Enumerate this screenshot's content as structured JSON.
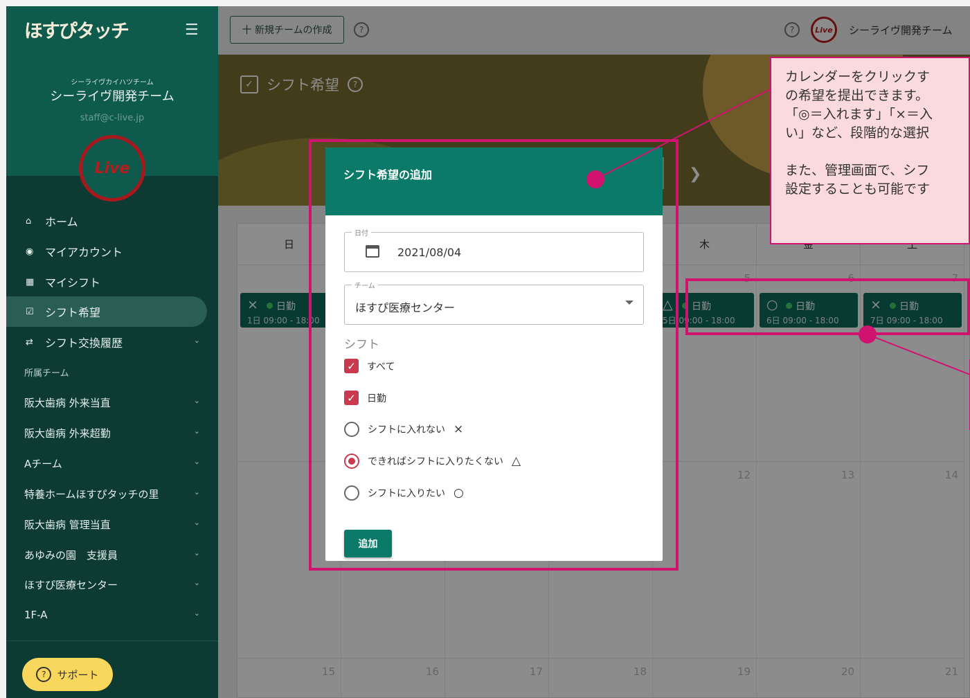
{
  "sidebar": {
    "logo": "ほすぴタッチ",
    "org_kana": "シーライヴカイハツチーム",
    "org_name": "シーライヴ開発チーム",
    "org_email": "staff@c-live.jp",
    "avatar_text": "Live",
    "nav": [
      {
        "label": "ホーム"
      },
      {
        "label": "マイアカウント"
      },
      {
        "label": "マイシフト"
      },
      {
        "label": "シフト希望"
      },
      {
        "label": "シフト交換履歴"
      }
    ],
    "teams_heading": "所属チーム",
    "teams": [
      "阪大歯病 外来当直",
      "阪大歯病 外来超勤",
      "Aチーム",
      "特養ホームほすぴタッチの里",
      "阪大歯病 管理当直",
      "あゆみの園　支援員",
      "ほすぴ医療センター",
      "1F-A"
    ],
    "support_label": "サポート"
  },
  "topbar": {
    "new_team_label": "十 新規チームの作成",
    "brand_mini": "Live",
    "team_selector": "シーライヴ開発チーム"
  },
  "page": {
    "title": "シフト希望"
  },
  "calendar": {
    "weekdays": [
      "日",
      "",
      "",
      "",
      "木",
      "金",
      "土"
    ],
    "week1_dates": [
      "",
      "",
      "",
      "",
      "5",
      "6",
      "7"
    ],
    "week2_dates": [
      "",
      "",
      "",
      "",
      "12",
      "13",
      "14"
    ],
    "week3_dates": [
      "15",
      "16",
      "17",
      "18",
      "19",
      "20",
      "21"
    ],
    "chips": [
      {
        "mark": "×",
        "label": "日勤",
        "time": "1日 09:00 - 18:00"
      },
      {
        "mark": "△",
        "label": "日勤",
        "time": "5日 09:00 - 18:00"
      },
      {
        "mark": "○",
        "label": "日勤",
        "time": "6日 09:00 - 18:00"
      },
      {
        "mark": "×",
        "label": "日勤",
        "time": "7日 09:00 - 18:00"
      }
    ]
  },
  "dialog": {
    "title": "シフト希望の追加",
    "date_label": "日付",
    "date_value": "2021/08/04",
    "team_label": "チーム",
    "team_value": "ほすぴ医療センター",
    "shift_label": "シフト",
    "checkboxes": [
      "すべて",
      "日勤"
    ],
    "radios": [
      {
        "label": "シフトに入れない",
        "symbol": "×"
      },
      {
        "label": "できればシフトに入りたくない",
        "symbol": "△"
      },
      {
        "label": "シフトに入りたい",
        "symbol": "○"
      }
    ],
    "selected_radio": "できればシフトに入りたくない",
    "add_label": "追加"
  },
  "callout": {
    "text": "カレンダーをクリックす\nの希望を提出できます。\n「◎＝入れます」「×＝入\nい」など、段階的な選択\n\nまた、管理画面で、シフ\n設定することも可能です"
  },
  "colors": {
    "accent": "#0b7a68",
    "highlight": "#d0136f",
    "checkbox": "#c93a4e",
    "sidebar": "#0d3b33"
  }
}
